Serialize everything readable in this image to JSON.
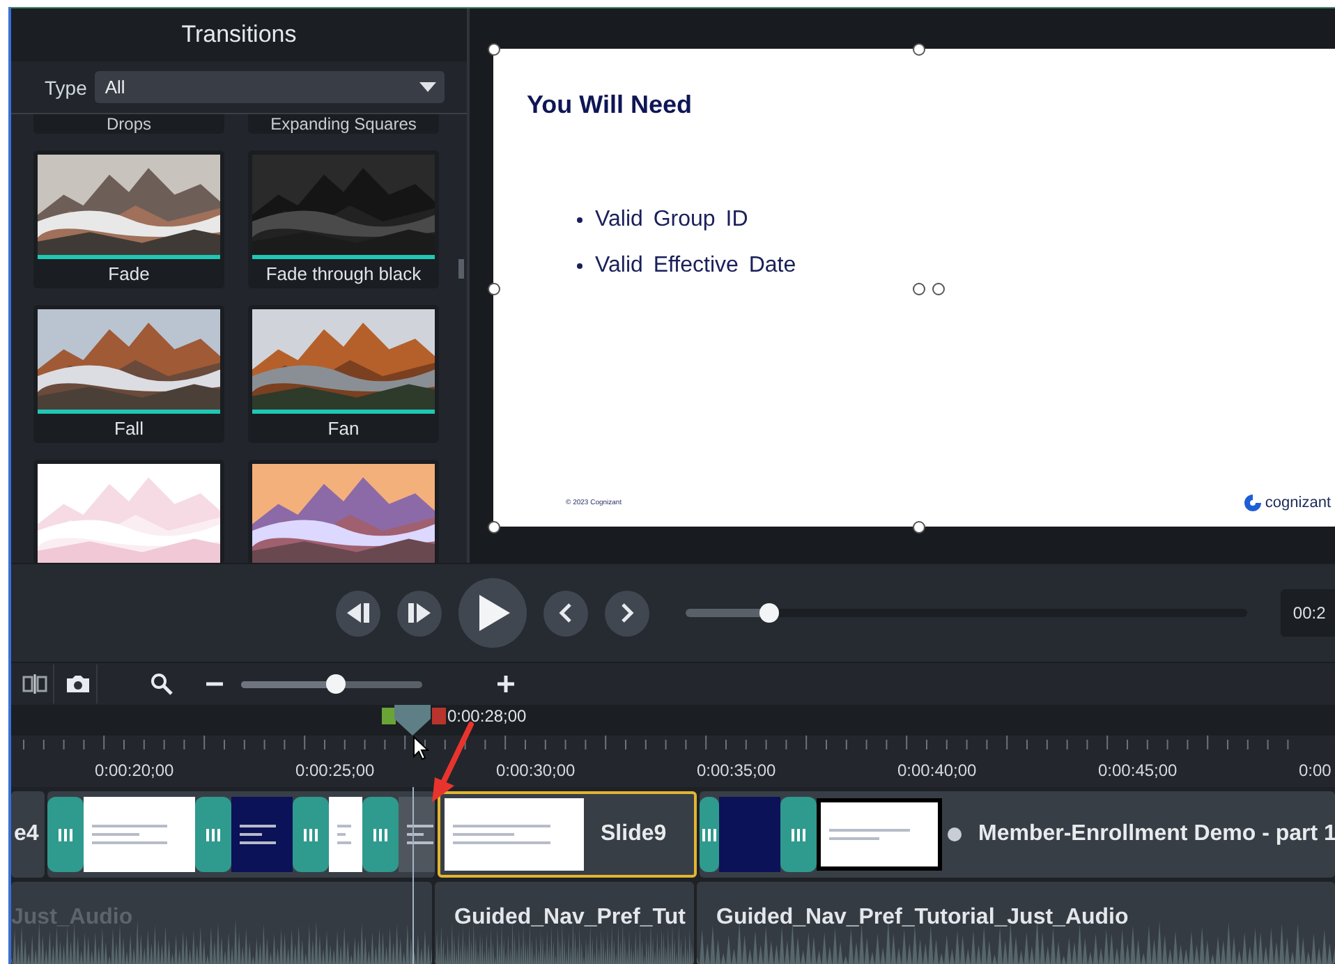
{
  "transitions_panel": {
    "title": "Transitions",
    "type_label": "Type",
    "type_value": "All",
    "tiles": [
      {
        "kind": "cut",
        "label": "Drops"
      },
      {
        "kind": "cut",
        "label": "Expanding Squares"
      },
      {
        "kind": "full",
        "label": "Fade"
      },
      {
        "kind": "full",
        "label": "Fade through black"
      },
      {
        "kind": "full",
        "label": "Fall"
      },
      {
        "kind": "full",
        "label": "Fan"
      },
      {
        "kind": "picture"
      },
      {
        "kind": "picture"
      }
    ]
  },
  "preview": {
    "slide": {
      "title": "You Will Need",
      "bullets": [
        "Valid Group ID",
        "Valid Effective Date"
      ],
      "footer": "© 2023 Cognizant",
      "logo": "cognizant"
    }
  },
  "playback": {
    "scrubber": {
      "level": 0.15
    },
    "time_display": "00:2"
  },
  "toolbar": {
    "zoom": {
      "level": 0.52
    }
  },
  "timeline": {
    "playhead_time": "0:00:28;00",
    "ruler_labels": [
      "0:00:20;00",
      "0:00:25;00",
      "0:00:30;00",
      "0:00:35;00",
      "0:00:40;00",
      "0:00:45;00",
      "0:00"
    ],
    "video_track": {
      "clips": [
        {
          "label": "e4",
          "selected": false
        },
        {
          "selected": false
        },
        {
          "label": "Slide9",
          "selected": true
        },
        {
          "label": "Member-Enrollment Demo - part 1",
          "selected": false
        }
      ]
    },
    "audio_track": {
      "clips": [
        {
          "label": "Just_Audio",
          "faded": true
        },
        {
          "label": "Guided_Nav_Pref_Tut",
          "faded": false
        },
        {
          "label": "Guided_Nav_Pref_Tutorial_Just_Audio",
          "faded": false
        }
      ]
    }
  }
}
